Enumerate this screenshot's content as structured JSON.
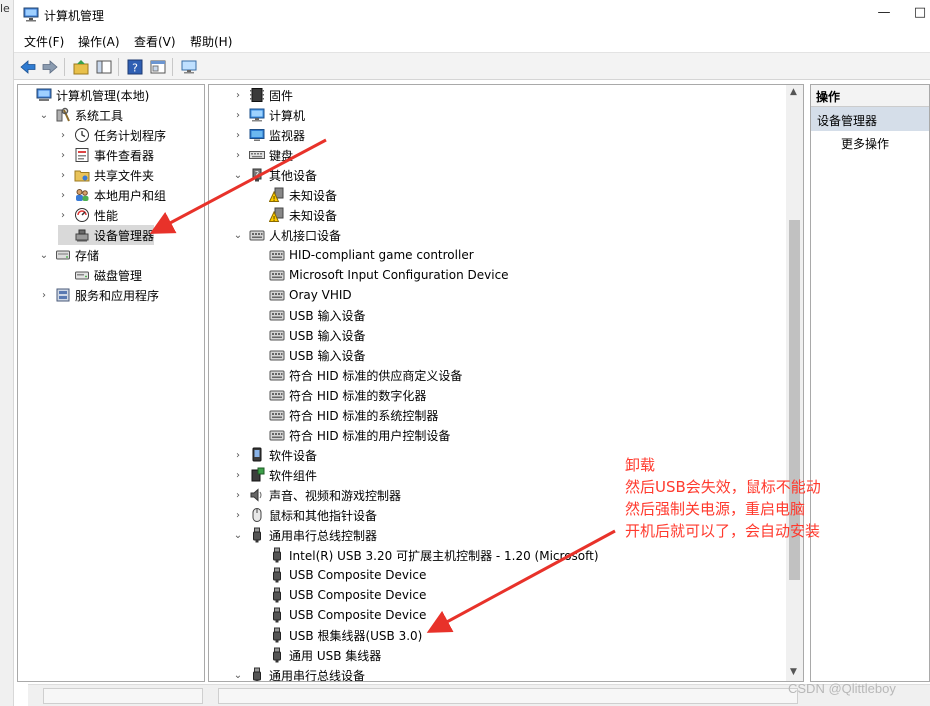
{
  "side_fragment": "le",
  "window": {
    "title": "计算机管理",
    "controls": [
      "—",
      "□"
    ]
  },
  "menu": [
    "文件(F)",
    "操作(A)",
    "查看(V)",
    "帮助(H)"
  ],
  "toolbar": [
    "back-icon",
    "forward-icon",
    "up-icon",
    "show-hide-tree-icon",
    "help-icon",
    "properties-icon",
    "monitor-icon"
  ],
  "left_tree": [
    {
      "label": "计算机管理(本地)",
      "icon": "computer-management-icon",
      "chev": "",
      "level": 0
    },
    {
      "label": "系统工具",
      "icon": "system-tools-icon",
      "chev": "⌄",
      "level": 1
    },
    {
      "label": "任务计划程序",
      "icon": "clock-icon",
      "chev": "›",
      "level": 2
    },
    {
      "label": "事件查看器",
      "icon": "event-viewer-icon",
      "chev": "›",
      "level": 2
    },
    {
      "label": "共享文件夹",
      "icon": "shared-folder-icon",
      "chev": "›",
      "level": 2
    },
    {
      "label": "本地用户和组",
      "icon": "users-icon",
      "chev": "›",
      "level": 2
    },
    {
      "label": "性能",
      "icon": "performance-icon",
      "chev": "›",
      "level": 2
    },
    {
      "label": "设备管理器",
      "icon": "device-manager-icon",
      "chev": "",
      "level": 2,
      "selected": true
    },
    {
      "label": "存储",
      "icon": "storage-icon",
      "chev": "⌄",
      "level": 1
    },
    {
      "label": "磁盘管理",
      "icon": "disk-icon",
      "chev": "",
      "level": 2
    },
    {
      "label": "服务和应用程序",
      "icon": "services-icon",
      "chev": "›",
      "level": 1
    }
  ],
  "device_tree": [
    {
      "label": "固件",
      "icon": "firmware-icon",
      "chev": "›",
      "level": 0
    },
    {
      "label": "计算机",
      "icon": "monitor-icon",
      "chev": "›",
      "level": 0
    },
    {
      "label": "监视器",
      "icon": "display-icon",
      "chev": "›",
      "level": 0
    },
    {
      "label": "键盘",
      "icon": "keyboard-icon",
      "chev": "›",
      "level": 0
    },
    {
      "label": "其他设备",
      "icon": "other-device-icon",
      "chev": "⌄",
      "level": 0
    },
    {
      "label": "未知设备",
      "icon": "warning-device-icon",
      "chev": "",
      "level": 1
    },
    {
      "label": "未知设备",
      "icon": "warning-device-icon",
      "chev": "",
      "level": 1
    },
    {
      "label": "人机接口设备",
      "icon": "hid-icon",
      "chev": "⌄",
      "level": 0
    },
    {
      "label": "HID-compliant game controller",
      "icon": "hid-icon",
      "chev": "",
      "level": 1
    },
    {
      "label": "Microsoft Input Configuration Device",
      "icon": "hid-icon",
      "chev": "",
      "level": 1
    },
    {
      "label": "Oray VHID",
      "icon": "hid-icon",
      "chev": "",
      "level": 1
    },
    {
      "label": "USB 输入设备",
      "icon": "hid-icon",
      "chev": "",
      "level": 1
    },
    {
      "label": "USB 输入设备",
      "icon": "hid-icon",
      "chev": "",
      "level": 1
    },
    {
      "label": "USB 输入设备",
      "icon": "hid-icon",
      "chev": "",
      "level": 1
    },
    {
      "label": "符合 HID 标准的供应商定义设备",
      "icon": "hid-icon",
      "chev": "",
      "level": 1
    },
    {
      "label": "符合 HID 标准的数字化器",
      "icon": "hid-icon",
      "chev": "",
      "level": 1
    },
    {
      "label": "符合 HID 标准的系统控制器",
      "icon": "hid-icon",
      "chev": "",
      "level": 1
    },
    {
      "label": "符合 HID 标准的用户控制设备",
      "icon": "hid-icon",
      "chev": "",
      "level": 1
    },
    {
      "label": "软件设备",
      "icon": "software-device-icon",
      "chev": "›",
      "level": 0
    },
    {
      "label": "软件组件",
      "icon": "software-component-icon",
      "chev": "›",
      "level": 0
    },
    {
      "label": "声音、视频和游戏控制器",
      "icon": "speaker-icon",
      "chev": "›",
      "level": 0
    },
    {
      "label": "鼠标和其他指针设备",
      "icon": "mouse-icon",
      "chev": "›",
      "level": 0
    },
    {
      "label": "通用串行总线控制器",
      "icon": "usb-icon",
      "chev": "⌄",
      "level": 0
    },
    {
      "label": "Intel(R) USB 3.20 可扩展主机控制器 - 1.20 (Microsoft)",
      "icon": "usb-icon",
      "chev": "",
      "level": 1
    },
    {
      "label": "USB Composite Device",
      "icon": "usb-icon",
      "chev": "",
      "level": 1
    },
    {
      "label": "USB Composite Device",
      "icon": "usb-icon",
      "chev": "",
      "level": 1
    },
    {
      "label": "USB Composite Device",
      "icon": "usb-icon",
      "chev": "",
      "level": 1
    },
    {
      "label": "USB 根集线器(USB 3.0)",
      "icon": "usb-icon",
      "chev": "",
      "level": 1
    },
    {
      "label": "通用 USB 集线器",
      "icon": "usb-icon",
      "chev": "",
      "level": 1
    },
    {
      "label": "通用串行总线设备",
      "icon": "usb-icon",
      "chev": "⌄",
      "level": 0
    }
  ],
  "actions": {
    "header": "操作",
    "selected": "设备管理器",
    "more": "更多操作"
  },
  "annotation": {
    "color": "#ff3a2e",
    "lines": [
      "卸载",
      "然后USB会失效，鼠标不能动",
      "然后强制关电源，重启电脑",
      "开机后就可以了，会自动安装"
    ]
  },
  "watermark": "CSDN @Qlittleboy"
}
